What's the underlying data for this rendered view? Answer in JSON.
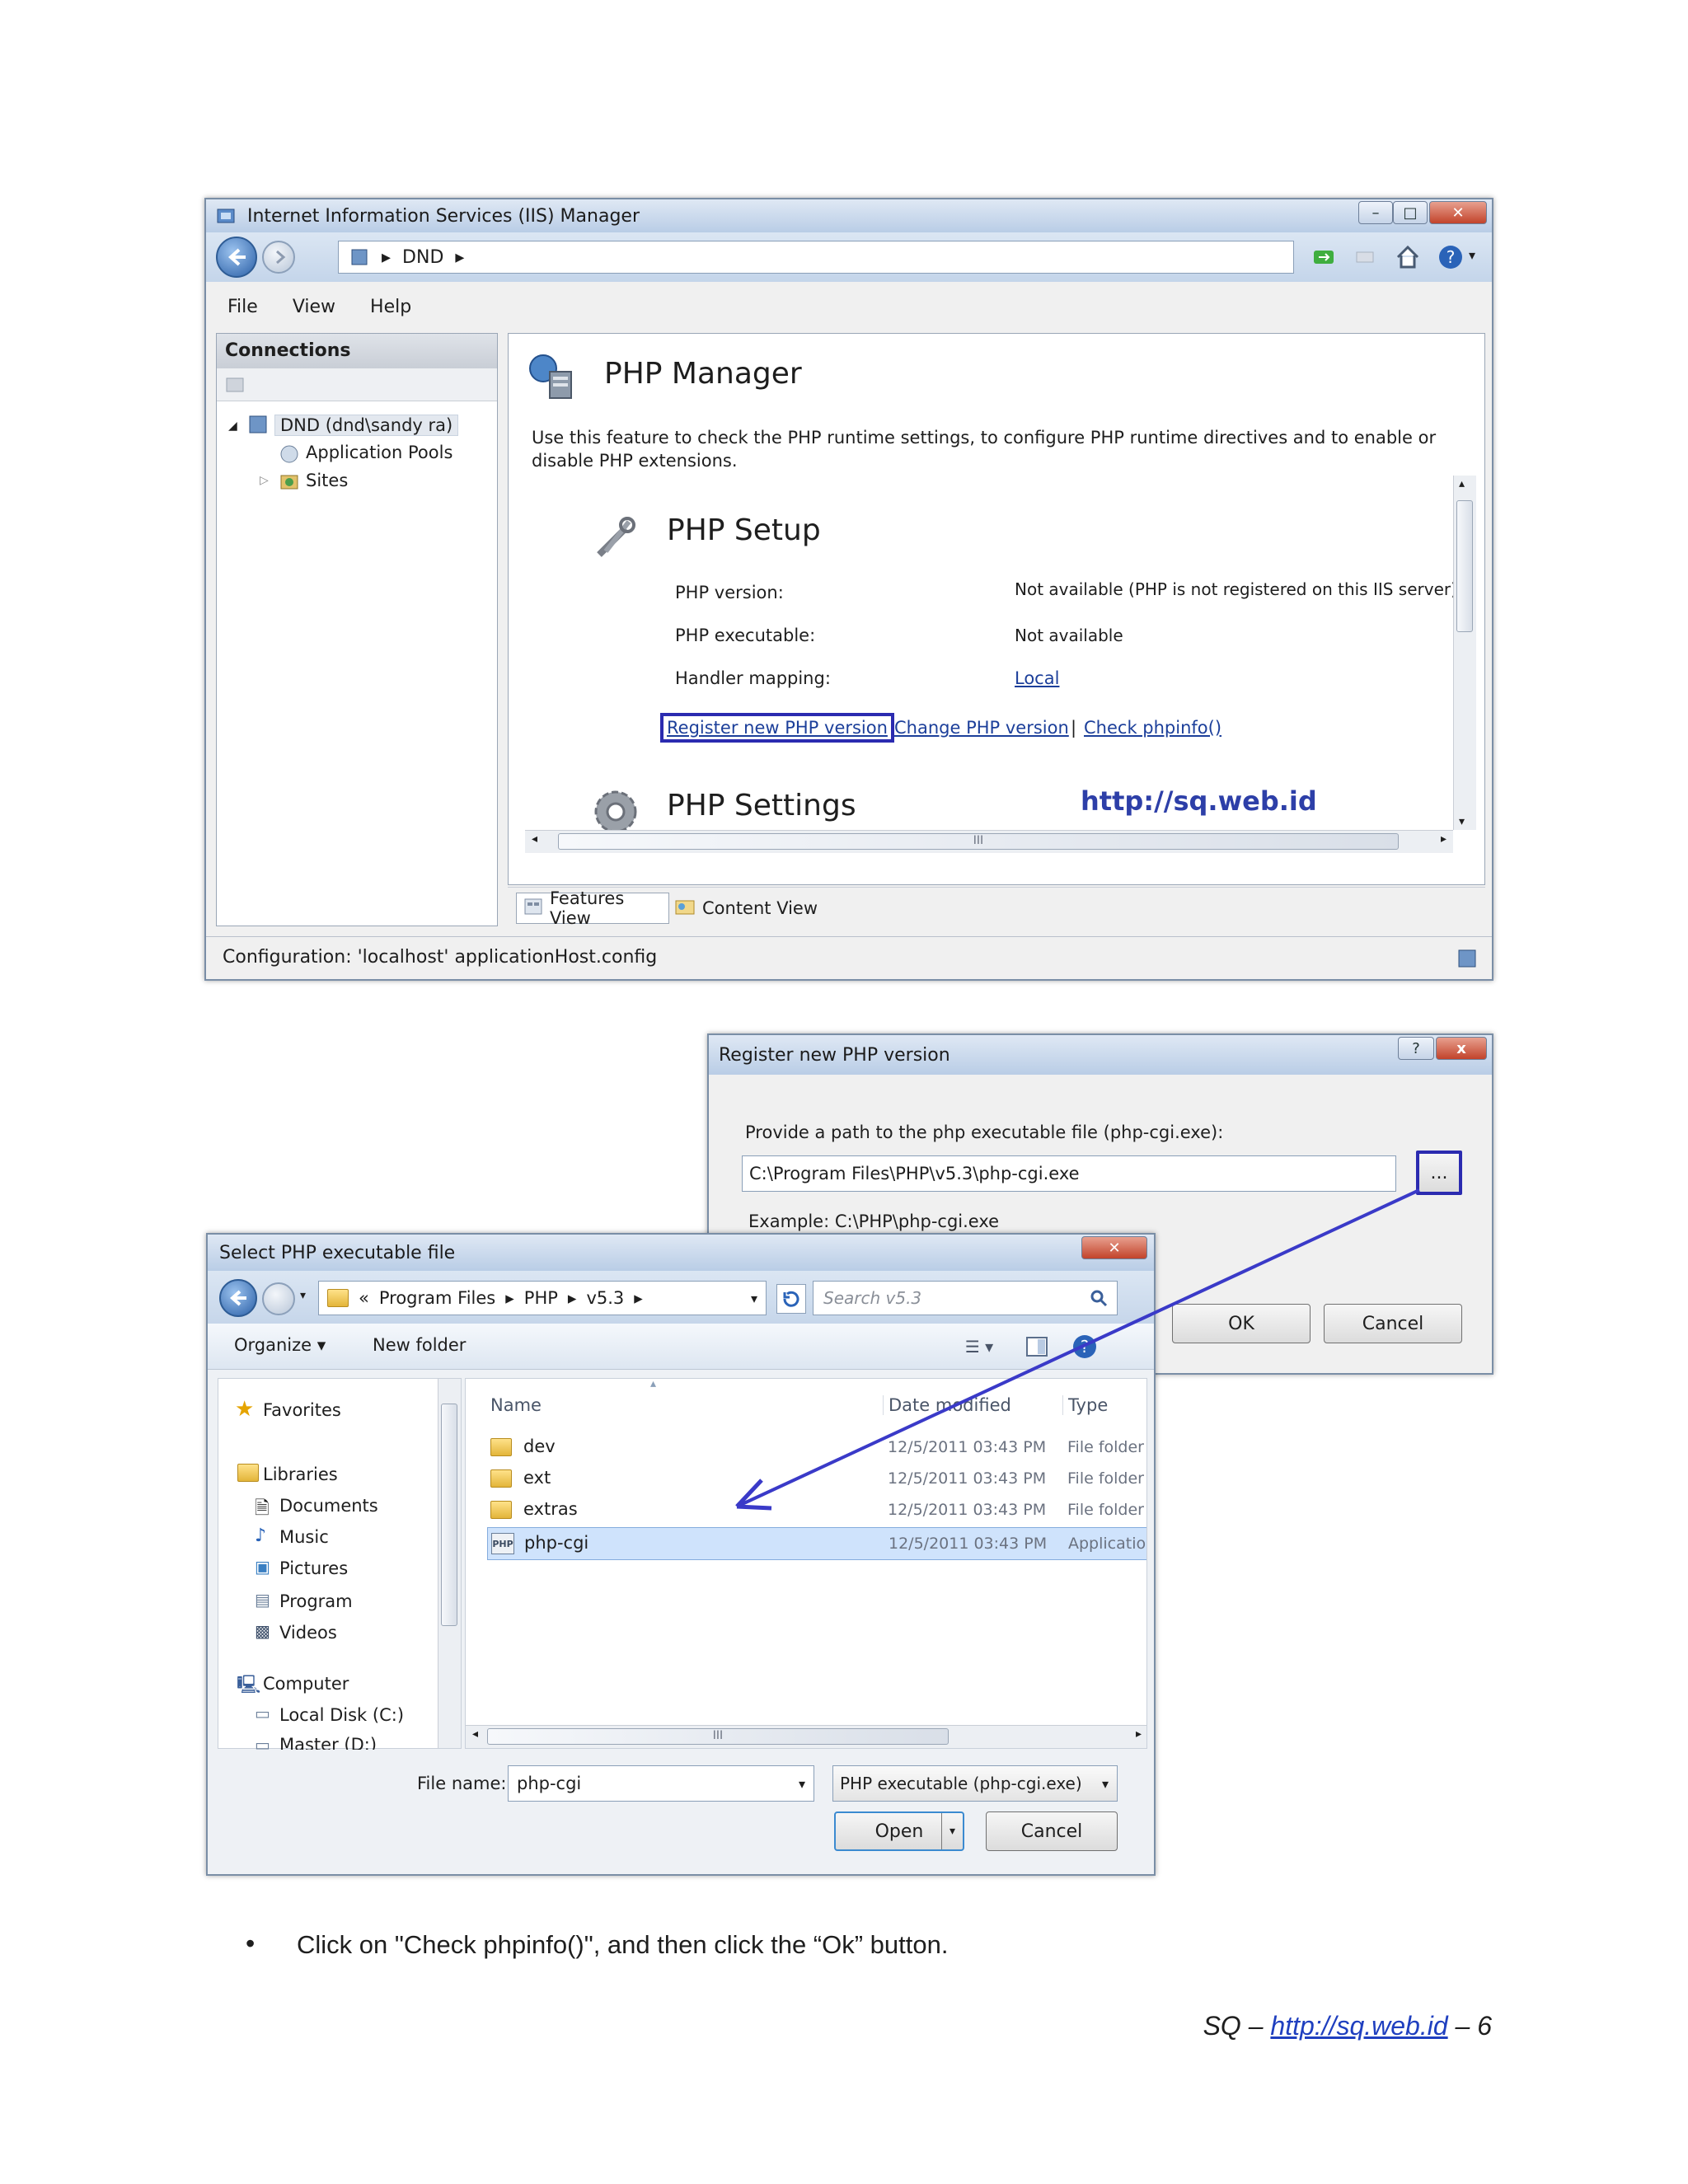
{
  "iis": {
    "title": "Internet Information Services (IIS) Manager",
    "breadcrumb": [
      "DND"
    ],
    "menu": [
      "File",
      "View",
      "Help"
    ],
    "connections_header": "Connections",
    "tree": {
      "server": "DND (dnd\\sandy ra)",
      "app_pools": "Application Pools",
      "sites": "Sites"
    },
    "content": {
      "title": "PHP Manager",
      "description_line1": "Use this feature to check the PHP runtime settings, to configure PHP runtime directives and to enable or",
      "description_line2": "disable PHP extensions.",
      "setup_title": "PHP Setup",
      "rows": [
        {
          "label": "PHP version:",
          "value": "Not available (PHP is not registered on this IIS server)"
        },
        {
          "label": "PHP executable:",
          "value": "Not available"
        },
        {
          "label": "Handler mapping:",
          "value": "Local"
        }
      ],
      "links": [
        "Register new PHP version",
        "Change PHP version",
        "Check phpinfo()"
      ],
      "sep": "|",
      "settings_title": "PHP Settings",
      "watermark": "http://sq.web.id",
      "scroll_mark": "III"
    },
    "views": {
      "features": "Features View",
      "content": "Content View"
    },
    "status": "Configuration: 'localhost' applicationHost.config"
  },
  "register": {
    "title": "Register new PHP version",
    "prompt": "Provide a path to the php executable file (php-cgi.exe):",
    "path_value": "C:\\Program Files\\PHP\\v5.3\\php-cgi.exe",
    "browse_label": "...",
    "example": "Example: C:\\PHP\\php-cgi.exe",
    "ok": "OK",
    "cancel": "Cancel",
    "help_glyph": "?",
    "close_glyph": "x"
  },
  "select": {
    "title": "Select PHP executable file",
    "path": [
      "«",
      "Program Files",
      "PHP",
      "v5.3"
    ],
    "search_placeholder": "Search v5.3",
    "organize": "Organize ▾",
    "new_folder": "New folder",
    "nav": {
      "favorites": "Favorites",
      "libraries": "Libraries",
      "documents": "Documents",
      "music": "Music",
      "pictures": "Pictures",
      "program": "Program",
      "videos": "Videos",
      "computer": "Computer",
      "local_disk": "Local Disk (C:)",
      "master": "Master (D:)"
    },
    "columns": {
      "name": "Name",
      "date": "Date modified",
      "type": "Type"
    },
    "files": [
      {
        "name": "dev",
        "date": "12/5/2011 03:43 PM",
        "type": "File folder"
      },
      {
        "name": "ext",
        "date": "12/5/2011 03:43 PM",
        "type": "File folder"
      },
      {
        "name": "extras",
        "date": "12/5/2011 03:43 PM",
        "type": "File folder"
      },
      {
        "name": "php-cgi",
        "date": "12/5/2011 03:43 PM",
        "type": "Application"
      }
    ],
    "file_icon_text": "PHP",
    "filename_label": "File name:",
    "filename_value": "php-cgi",
    "filter": "PHP executable (php-cgi.exe)",
    "open": "Open",
    "cancel": "Cancel",
    "scroll_mark": "III"
  },
  "instruction": "Click on \"Check phpinfo()\", and then click the “Ok” button.",
  "footer": {
    "prefix": "SQ – ",
    "link": "http://sq.web.id",
    "suffix": " – 6"
  },
  "colors": {
    "highlight_box": "#2b2bb0",
    "arrow": "#3a3ac8",
    "selected_row": "#cfe3fc"
  }
}
